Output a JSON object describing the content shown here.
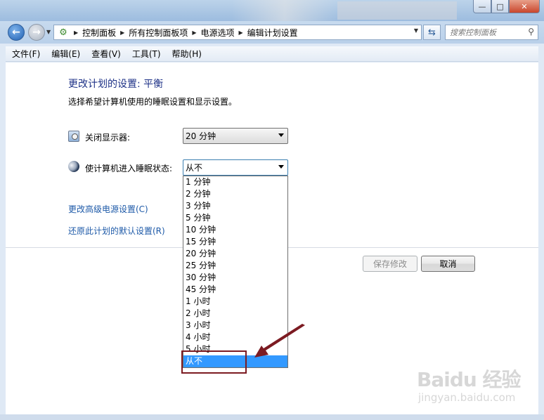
{
  "window": {
    "minimize_glyph": "—",
    "maximize_glyph": "□",
    "close_glyph": "✕"
  },
  "address_bar": {
    "icon": "control-panel-icon",
    "breadcrumbs": [
      "控制面板",
      "所有控制面板项",
      "电源选项",
      "编辑计划设置"
    ],
    "search_placeholder": "搜索控制面板"
  },
  "menu": {
    "items": [
      "文件(F)",
      "编辑(E)",
      "查看(V)",
      "工具(T)",
      "帮助(H)"
    ]
  },
  "main": {
    "title": "更改计划的设置: 平衡",
    "subtitle": "选择希望计算机使用的睡眠设置和显示设置。",
    "display_off_label": "关闭显示器:",
    "display_off_value": "20 分钟",
    "sleep_label": "使计算机进入睡眠状态:",
    "sleep_value": "从不",
    "sleep_options": [
      "1 分钟",
      "2 分钟",
      "3 分钟",
      "5 分钟",
      "10 分钟",
      "15 分钟",
      "20 分钟",
      "25 分钟",
      "30 分钟",
      "45 分钟",
      "1 小时",
      "2 小时",
      "3 小时",
      "4 小时",
      "5 小时",
      "从不"
    ],
    "sleep_selected_index": 15,
    "advanced_link": "更改高级电源设置(C)",
    "restore_link": "还原此计划的默认设置(R)",
    "save_button": "保存修改",
    "cancel_button": "取消"
  },
  "watermark": {
    "logo": "Baidu 经验",
    "url": "jingyan.baidu.com"
  },
  "colors": {
    "title": "#1e3287",
    "link": "#1e5aa8",
    "selection": "#3399ff",
    "annotation": "#7c1b22"
  }
}
